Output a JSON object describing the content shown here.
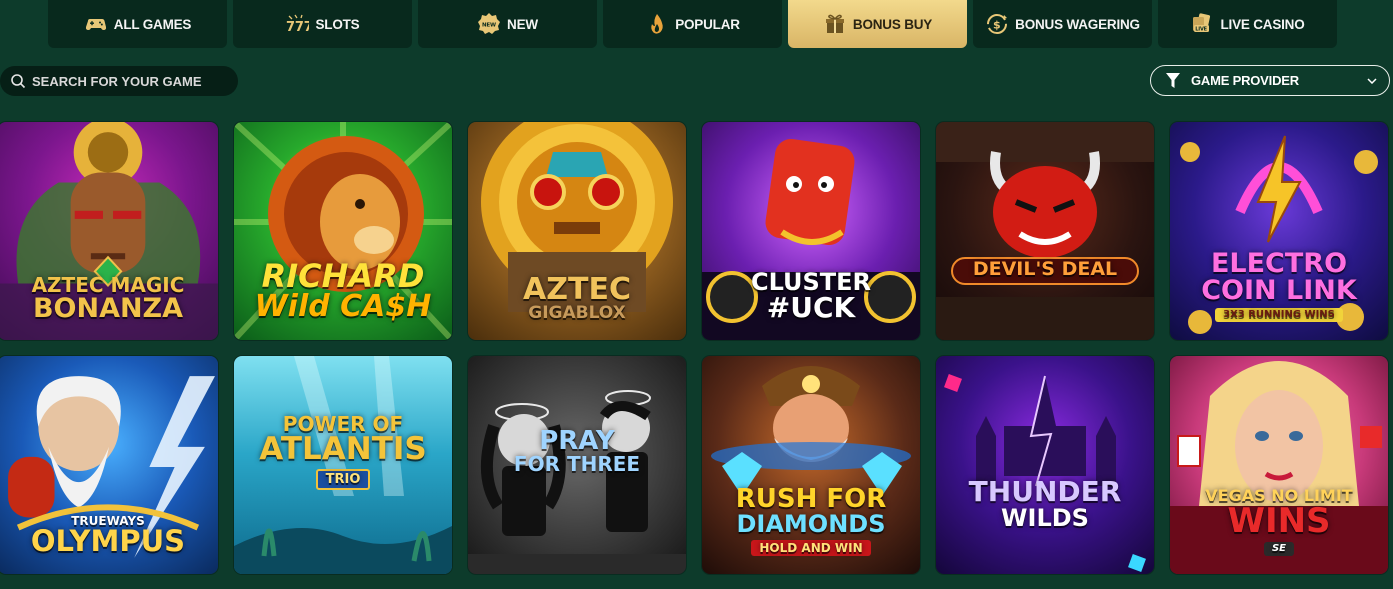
{
  "tabs": [
    {
      "label": "ALL GAMES",
      "icon": "gamepad-icon",
      "active": false
    },
    {
      "label": "SLOTS",
      "icon": "slots-777-icon",
      "active": false
    },
    {
      "label": "NEW",
      "icon": "new-badge-icon",
      "active": false
    },
    {
      "label": "POPULAR",
      "icon": "flame-icon",
      "active": false
    },
    {
      "label": "BONUS BUY",
      "icon": "gift-icon",
      "active": true
    },
    {
      "label": "BONUS WAGERING",
      "icon": "dollar-cycle-icon",
      "active": false
    },
    {
      "label": "LIVE CASINO",
      "icon": "live-cards-icon",
      "active": false
    }
  ],
  "search": {
    "placeholder": "SEARCH FOR YOUR GAME",
    "value": ""
  },
  "provider": {
    "label": "GAME PROVIDER"
  },
  "games": [
    {
      "line1": "AZTEC MAGIC",
      "line2": "BONANZA",
      "tag": ""
    },
    {
      "line1": "RICHARD",
      "line2": "Wild CA$H",
      "tag": ""
    },
    {
      "line1": "AZTEC",
      "line2": "GIGABLOX",
      "tag": ""
    },
    {
      "line1": "CLUSTER",
      "line2": "#UCK",
      "tag": ""
    },
    {
      "line1": "DEVIL'S DEAL",
      "line2": "",
      "tag": ""
    },
    {
      "line1": "ELECTRO",
      "line2": "COIN LINK",
      "tag": "3X3 RUNNING WINS"
    },
    {
      "line1": "TRUEWAYS",
      "line2": "OLYMPUS",
      "tag": ""
    },
    {
      "line1": "POWER OF",
      "line2": "ATLANTIS",
      "tag": "TRIO"
    },
    {
      "line1": "PRAY",
      "line2": "FOR THREE",
      "tag": ""
    },
    {
      "line1": "RUSH FOR",
      "line2": "DIAMONDS",
      "tag": "HOLD AND WIN"
    },
    {
      "line1": "THUNDER",
      "line2": "WILDS",
      "tag": ""
    },
    {
      "line1": "VEGAS NO LIMIT",
      "line2": "WINS",
      "tag": "SE"
    }
  ],
  "colors": {
    "background": "#0d3b2b",
    "tab": "#08291d",
    "active_tab": "#e3c474"
  }
}
